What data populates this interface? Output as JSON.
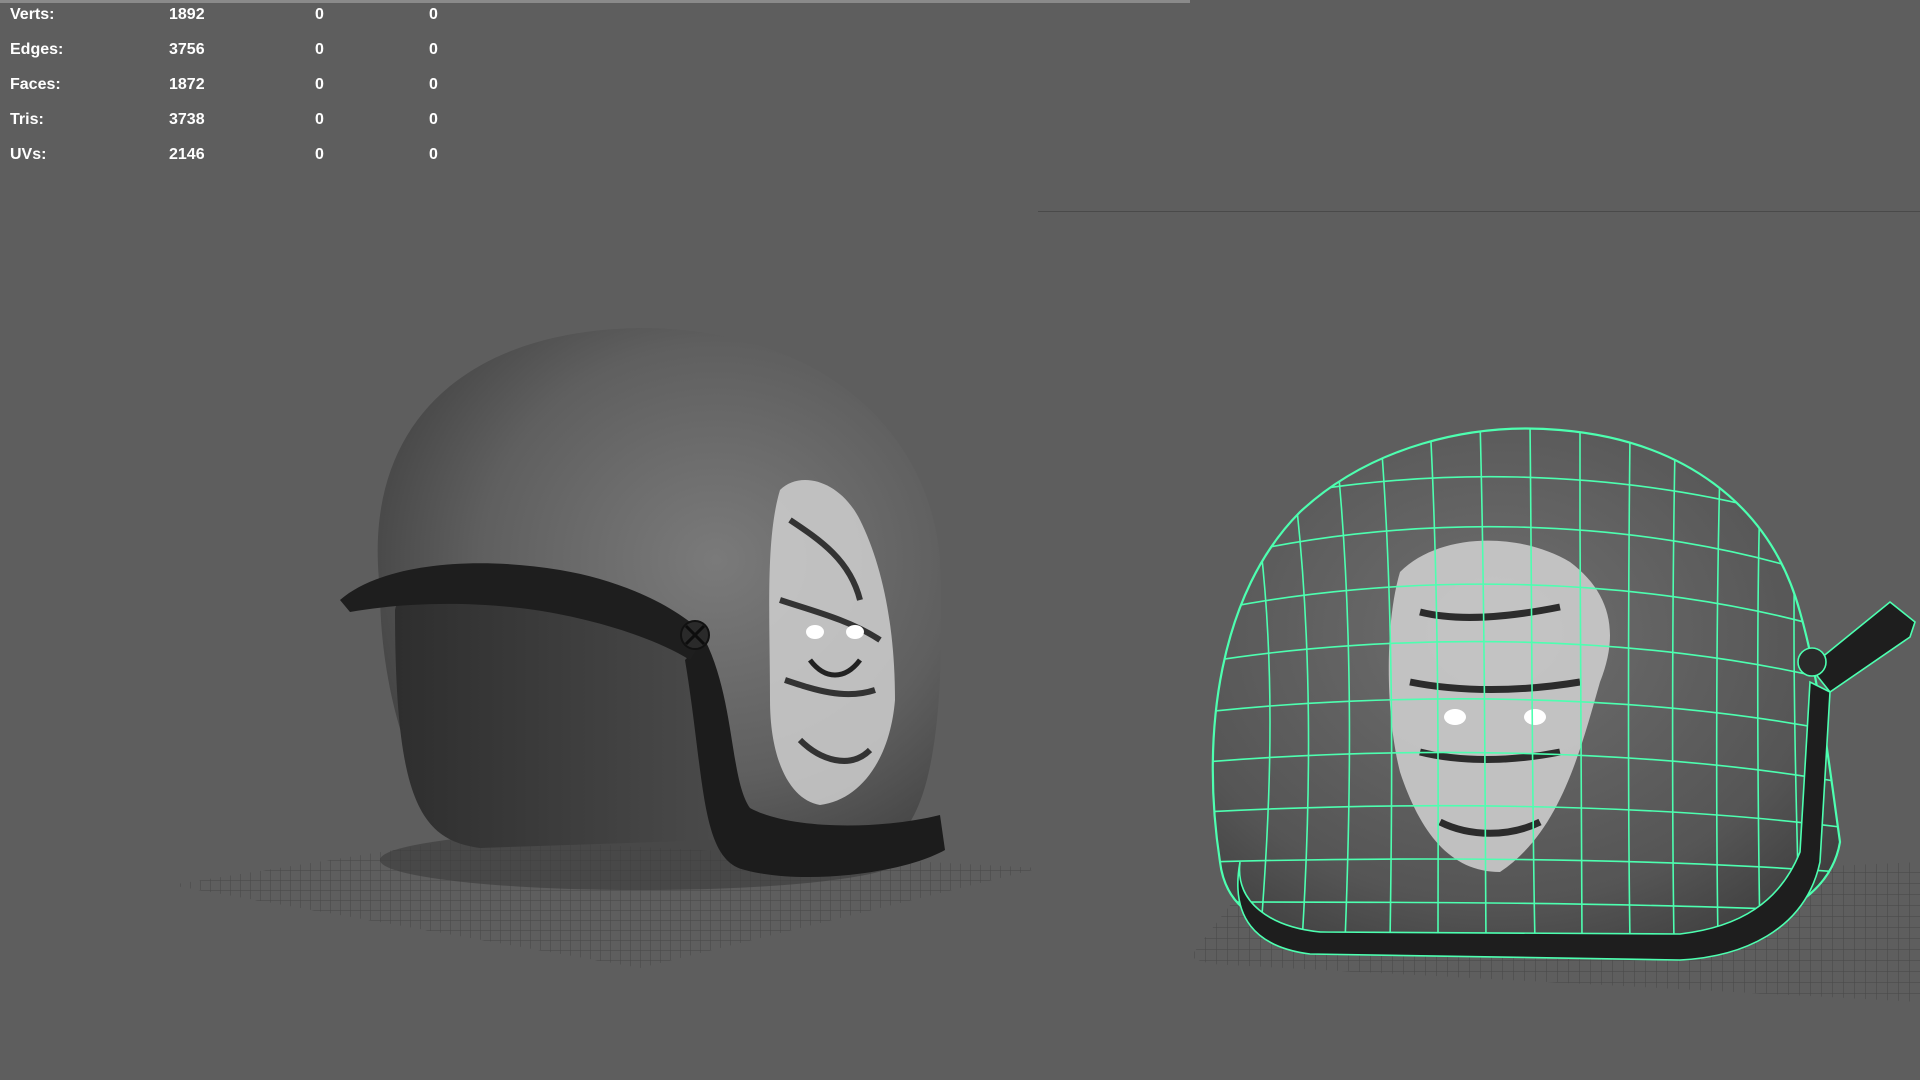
{
  "hud": {
    "rows": [
      {
        "label": "Verts:",
        "total": "1892",
        "selected": "0",
        "component": "0"
      },
      {
        "label": "Edges:",
        "total": "3756",
        "selected": "0",
        "component": "0"
      },
      {
        "label": "Faces:",
        "total": "1872",
        "selected": "0",
        "component": "0"
      },
      {
        "label": "Tris:",
        "total": "3738",
        "selected": "0",
        "component": "0"
      },
      {
        "label": "UVs:",
        "total": "2146",
        "selected": "0",
        "component": "0"
      }
    ]
  },
  "colors": {
    "background": "#5e5e5e",
    "wireframe": "#4dffb0",
    "helmet_shell": "#6a6a6a",
    "helmet_trim": "#1c1c1c"
  },
  "viewports": {
    "left": {
      "mode": "shaded"
    },
    "right": {
      "mode": "wireframe-on-shaded"
    }
  }
}
